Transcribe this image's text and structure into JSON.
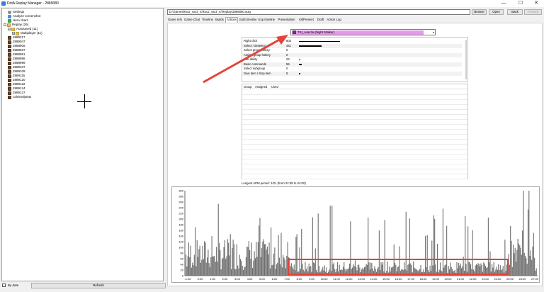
{
  "window": {
    "title": "DotA Replay Manager - 2889080",
    "controls": {
      "minimize": "—",
      "maximize": "☐",
      "close": "✕"
    }
  },
  "tree": {
    "items": [
      {
        "label": "Settings",
        "icon": "gear-icon",
        "level": 1
      },
      {
        "label": "Analyze screenshot",
        "icon": "camera-icon",
        "level": 1
      },
      {
        "label": "Hero chart",
        "icon": "chart-icon",
        "level": 1
      },
      {
        "label": "Replay (26)",
        "icon": "folder-icon",
        "level": 0,
        "expander": "−"
      },
      {
        "label": "Autosaved (11)",
        "icon": "folder-icon",
        "level": 1,
        "expander": "+"
      },
      {
        "label": "Multiplayer (11)",
        "icon": "folder-icon",
        "level": 2,
        "expander": "+"
      },
      {
        "label": "2889217",
        "icon": "replay-icon",
        "level": 1
      },
      {
        "label": "2889047",
        "icon": "replay-icon",
        "level": 1
      },
      {
        "label": "2888905",
        "icon": "replay-icon",
        "level": 1
      },
      {
        "label": "2888937",
        "icon": "replay-icon",
        "level": 1
      },
      {
        "label": "2888961",
        "icon": "replay-icon",
        "level": 1
      },
      {
        "label": "2888986",
        "icon": "replay-icon",
        "level": 1
      },
      {
        "label": "2888999",
        "icon": "replay-icon",
        "level": 1
      },
      {
        "label": "2889107",
        "icon": "replay-icon",
        "level": 1
      },
      {
        "label": "2889109",
        "icon": "replay-icon",
        "level": 1
      },
      {
        "label": "2889115",
        "icon": "replay-icon",
        "level": 1
      },
      {
        "label": "2889120",
        "icon": "replay-icon",
        "level": 1
      },
      {
        "label": "2889122",
        "icon": "replay-icon",
        "level": 1
      },
      {
        "label": "2889124",
        "icon": "replay-icon",
        "level": 1
      },
      {
        "label": "2889127",
        "icon": "replay-icon",
        "level": 1
      },
      {
        "label": "calvinedpeas",
        "icon": "replay-icon",
        "level": 1
      }
    ]
  },
  "bottom": {
    "by_date_label": "By date",
    "refresh_label": "Refresh"
  },
  "toolbar": {
    "path": "D:\\Games\\knuz_var3_rc\\knuz_var3_rc\\Replay\\2889080.w3g",
    "browse": "Browse",
    "open": "Open",
    "back": "Back",
    "forward": "Forward"
  },
  "tabs": [
    "Game Info",
    "Game Chat",
    "Timeline",
    "Builds",
    "Actions",
    "Gold timeline",
    "Exp timeline",
    "Presentation",
    "KillPresent",
    "Draft",
    "Action Log"
  ],
  "active_tab": "Actions",
  "player_select": {
    "value": "TSI_Avac3a (Night Stalker)"
  },
  "actions": [
    {
      "label": "Right click",
      "value": "803",
      "bar": 1.0
    },
    {
      "label": "Select / deselect",
      "value": "441",
      "bar": 0.55
    },
    {
      "label": "Select group hotkey",
      "value": "0",
      "bar": 0
    },
    {
      "label": "Assign group hotkey",
      "value": "0",
      "bar": 0
    },
    {
      "label": "Use ability",
      "value": "23",
      "bar": 0.03
    },
    {
      "label": "Basic commands",
      "value": "59",
      "bar": 0.07
    },
    {
      "label": "Select subgroup",
      "value": "0",
      "bar": 0
    },
    {
      "label": "Give item / drop item",
      "value": "8",
      "bar": 0.01
    }
  ],
  "group_table": {
    "headers": [
      "Group",
      "Assigned",
      "Used"
    ]
  },
  "apm": {
    "longest_label": "Longest APM period: 1/21 (from 22:38 to 24:00)"
  },
  "chart_data": {
    "type": "bar",
    "yticks": [
      "300",
      "280",
      "260",
      "240",
      "220",
      "200",
      "180",
      "160",
      "140",
      "120",
      "100",
      "80",
      "60",
      "40",
      "20",
      "0"
    ],
    "xticks": [
      "-1:00",
      "0:00",
      "1:00",
      "2:00",
      "3:00",
      "4:00",
      "5:00",
      "6:00",
      "7:00",
      "8:00",
      "9:00",
      "10:00",
      "11:00",
      "12:00",
      "13:00",
      "14:00",
      "15:00",
      "16:00",
      "17:00",
      "18:00",
      "19:00",
      "20:00",
      "21:00",
      "22:00",
      "23:00",
      "24:00",
      "25:00",
      "26:00",
      "27:00"
    ],
    "ylim": [
      0,
      300
    ],
    "bar_color": "#6e6e6e"
  },
  "colors": {
    "annotation": "#e0443a",
    "selection": "#e49ae8"
  }
}
